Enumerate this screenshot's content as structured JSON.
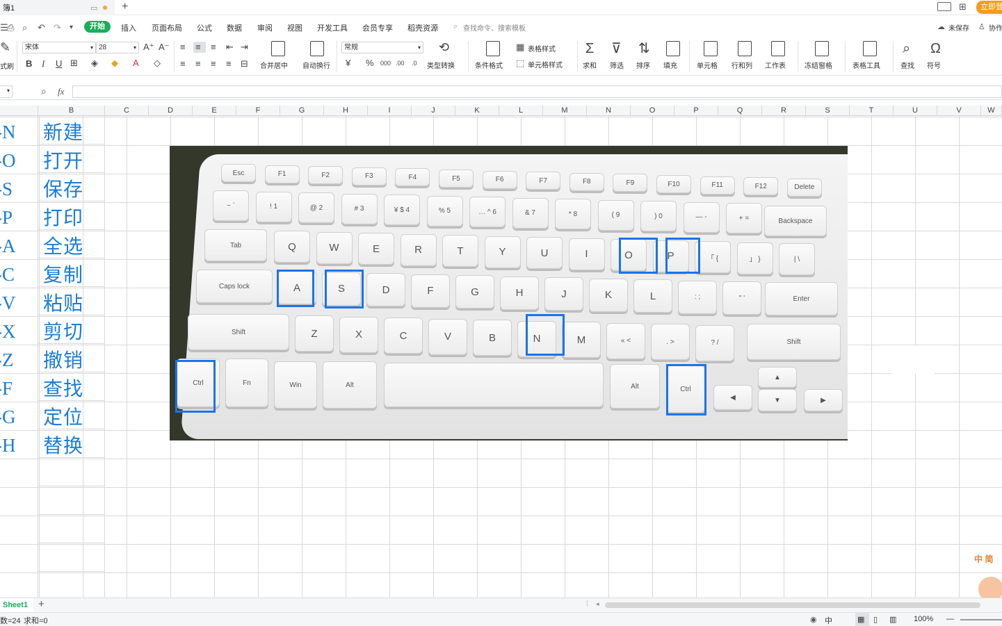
{
  "titlebar": {
    "doc_tab": "簿1",
    "new_tab": "+",
    "login_button": "立即登"
  },
  "menubar": {
    "tabs": [
      "开始",
      "插入",
      "页面布局",
      "公式",
      "数据",
      "审阅",
      "视图",
      "开发工具",
      "会员专享",
      "稻壳资源"
    ],
    "search_placeholder": "查找命令、搜索模板",
    "unsaved": "未保存",
    "collab": "协作"
  },
  "ribbon": {
    "format_painter": "式刷",
    "font_name": "宋体",
    "font_size": "28",
    "number_format": "常规",
    "merge_center": "合并居中",
    "wrap_text": "自动换行",
    "type_convert": "类型转换",
    "conditional_format": "条件格式",
    "table_style": "表格样式",
    "cell_style": "单元格样式",
    "sum": "求和",
    "filter": "筛选",
    "sort": "排序",
    "fill": "填充",
    "cell": "单元格",
    "row_col": "行和列",
    "worksheet": "工作表",
    "freeze": "冻结窗格",
    "table_tools": "表格工具",
    "find": "查找",
    "symbol": "符号",
    "bold": "B",
    "italic": "I",
    "underline": "U",
    "currency": "¥",
    "percent": "%"
  },
  "formulabar": {
    "fx": "fx"
  },
  "columns": [
    "B",
    "C",
    "D",
    "E",
    "F",
    "G",
    "H",
    "I",
    "J",
    "K",
    "L",
    "M",
    "N",
    "O",
    "P",
    "Q",
    "R",
    "S",
    "T",
    "U",
    "V",
    "W"
  ],
  "rows": [
    {
      "key": "-N",
      "action": "新建"
    },
    {
      "key": "-O",
      "action": "打开"
    },
    {
      "key": "-S",
      "action": "保存"
    },
    {
      "key": "-P",
      "action": "打印"
    },
    {
      "key": "-A",
      "action": "全选"
    },
    {
      "key": "-C",
      "action": "复制"
    },
    {
      "key": "-V",
      "action": "粘贴"
    },
    {
      "key": "-X",
      "action": "剪切"
    },
    {
      "key": "-Z",
      "action": "撤销"
    },
    {
      "key": "-F",
      "action": "查找"
    },
    {
      "key": "-G",
      "action": "定位"
    },
    {
      "key": "-H",
      "action": "替换"
    }
  ],
  "keyboard": {
    "fn_row": [
      "Esc",
      "F1",
      "F2",
      "F3",
      "F4",
      "F5",
      "F6",
      "F7",
      "F8",
      "F9",
      "F10",
      "F11",
      "F12",
      "Delete"
    ],
    "num_row": [
      "~ `",
      "! 1",
      "@ 2",
      "# 3",
      "¥ $ 4",
      "% 5",
      "… ^ 6",
      "& 7",
      "* 8",
      "( 9",
      ") 0",
      "— -",
      "+ ="
    ],
    "backspace": "Backspace",
    "tab": "Tab",
    "q_row": [
      "Q",
      "W",
      "E",
      "R",
      "T",
      "Y",
      "U",
      "I",
      "O",
      "P",
      "「 {",
      "」 }",
      "| \\"
    ],
    "caps": "Caps lock",
    "a_row": [
      "A",
      "S",
      "D",
      "F",
      "G",
      "H",
      "J",
      "K",
      "L",
      ": ;",
      "\" '"
    ],
    "enter": "Enter",
    "shift_left": "Shift",
    "z_row": [
      "Z",
      "X",
      "C",
      "V",
      "B",
      "N",
      "M",
      "« <",
      ". >",
      "? /"
    ],
    "shift_right": "Shift",
    "ctrl_left": "Ctrl",
    "fn": "Fn",
    "win": "Win",
    "alt_left": "Alt",
    "alt_right": "Alt",
    "ctrl_right": "Ctrl",
    "arrows": [
      "◀",
      "▲",
      "▼",
      "▶"
    ],
    "highlighted_keys": [
      "Ctrl",
      "A",
      "S",
      "O",
      "P",
      "N",
      "Ctrl"
    ]
  },
  "sheetbar": {
    "sheet_name": "Sheet1",
    "add_sheet": "+"
  },
  "statusbar": {
    "count": "数=24",
    "sum": "求和=0",
    "input_mode": "中",
    "zoom": "100%"
  },
  "mascot_text": "中 简"
}
